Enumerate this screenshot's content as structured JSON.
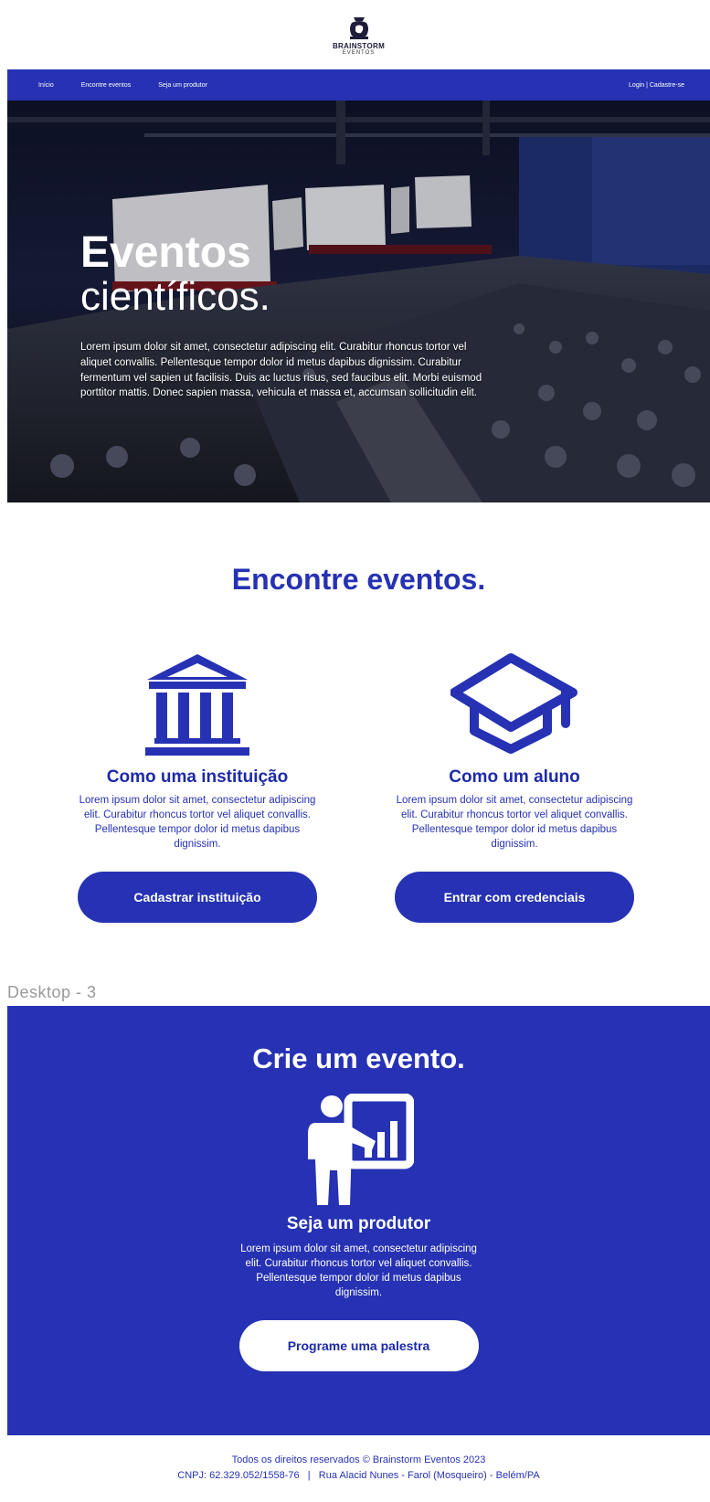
{
  "brand": {
    "name": "BRAINSTORM",
    "sub": "EVENTOS"
  },
  "nav": {
    "items": [
      {
        "label": "Início"
      },
      {
        "label": "Encontre eventos"
      },
      {
        "label": "Seja um produtor"
      }
    ],
    "auth": "Login | Cadastre-se"
  },
  "hero": {
    "title": "Eventos",
    "subtitle": "científicos.",
    "text": "Lorem ipsum dolor sit amet, consectetur adipiscing elit. Curabitur rhoncus tortor vel aliquet convallis. Pellentesque tempor dolor id metus dapibus dignissim. Curabitur fermentum vel sapien ut facilisis. Duis ac luctus risus, sed faucibus elit. Morbi euismod porttitor mattis. Donec sapien massa, vehicula et massa et, accumsan sollicitudin elit."
  },
  "find": {
    "title": "Encontre eventos.",
    "cards": [
      {
        "icon": "institution-icon",
        "title": "Como uma instituição",
        "text": "Lorem ipsum dolor sit amet, consectetur adipiscing elit. Curabitur rhoncus tortor vel aliquet convallis. Pellentesque tempor dolor id metus dapibus dignissim.",
        "button": "Cadastrar instituição"
      },
      {
        "icon": "graduation-cap-icon",
        "title": "Como um aluno",
        "text": "Lorem ipsum dolor sit amet, consectetur adipiscing elit. Curabitur rhoncus tortor vel aliquet convallis. Pellentesque tempor dolor id metus dapibus dignissim.",
        "button": "Entrar com credenciais"
      }
    ]
  },
  "frame_label": "Desktop - 3",
  "create": {
    "title": "Crie um evento.",
    "icon": "presenter-icon",
    "card_title": "Seja um produtor",
    "text": "Lorem ipsum dolor sit amet, consectetur adipiscing elit. Curabitur rhoncus tortor vel aliquet convallis. Pellentesque tempor dolor id metus dapibus dignissim.",
    "button": "Programe uma palestra"
  },
  "footer": {
    "line1": "Todos os direitos reservados © Brainstorm Eventos 2023",
    "line2": "CNPJ: 62.329.052/1558-76   |   Rua Alacid Nunes - Farol (Mosqueiro) - Belém/PA"
  },
  "colors": {
    "primary": "#2632b3",
    "white": "#ffffff"
  }
}
